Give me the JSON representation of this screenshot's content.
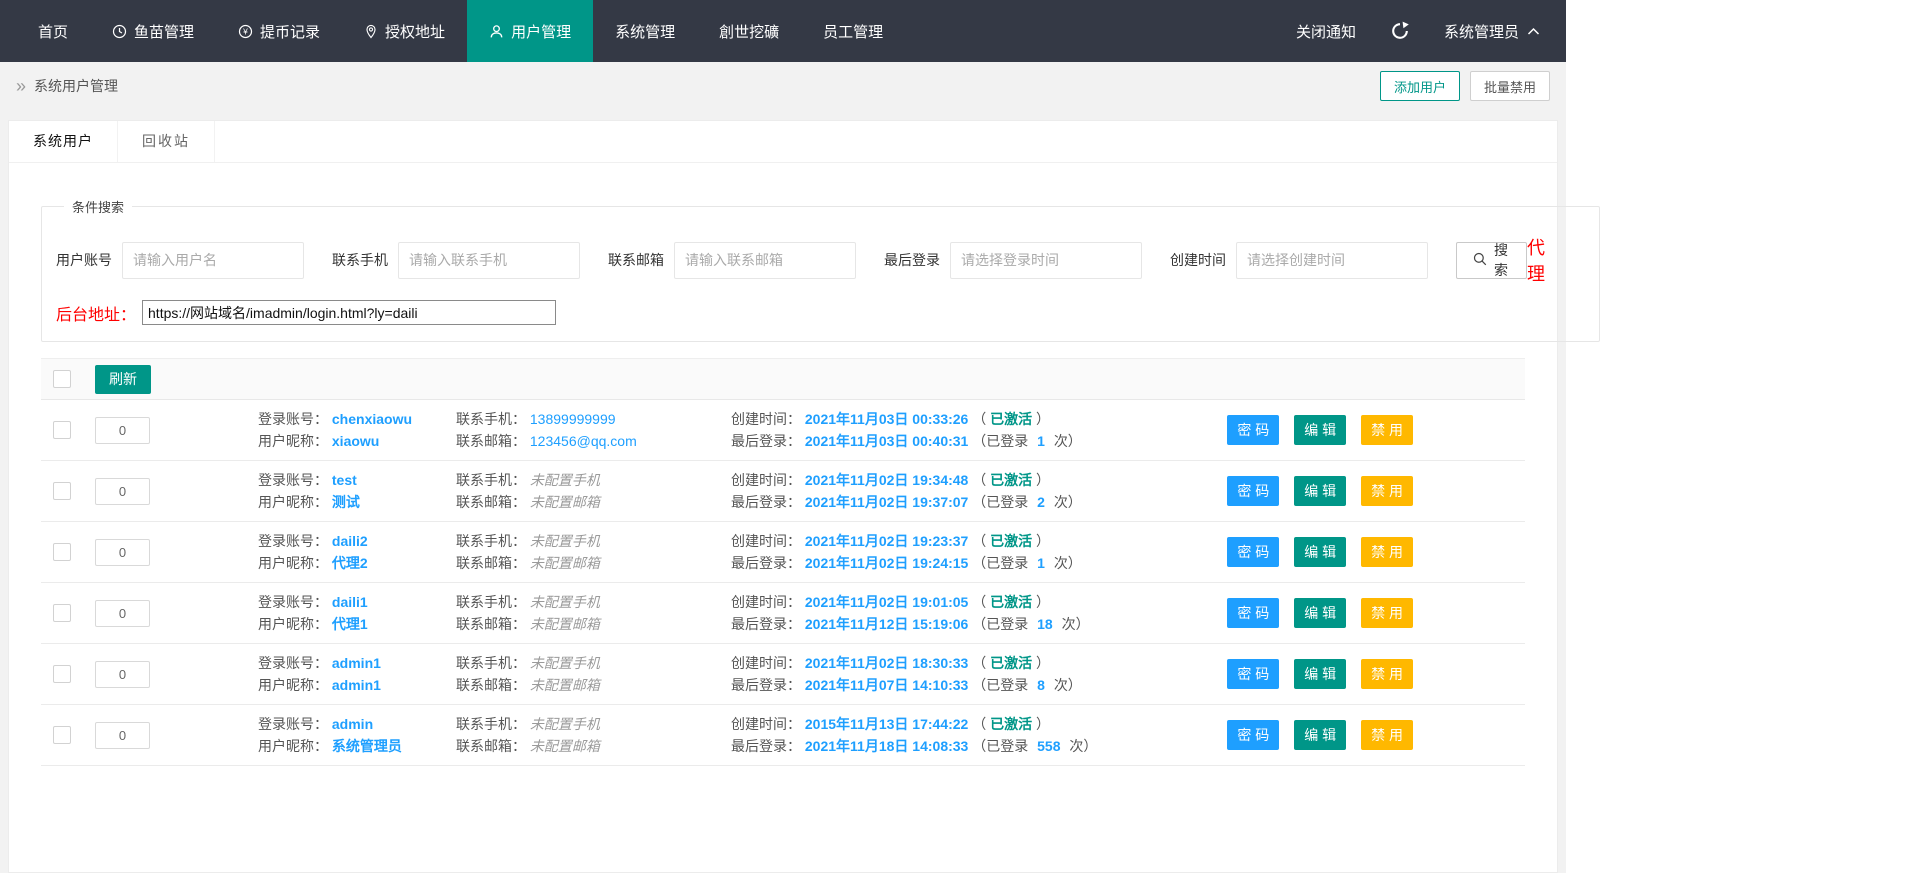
{
  "colors": {
    "nav_bg": "#343945",
    "primary_green": "#009688",
    "link_blue": "#1E9FFF",
    "warn_orange": "#FFB800",
    "alert_red": "#FF0000"
  },
  "icons": {
    "clock": "clock-icon",
    "yen": "yen-circle-icon",
    "pin": "location-pin-icon",
    "user": "user-icon",
    "refresh": "refresh-icon",
    "chevron_up": "chevron-up-icon",
    "search": "search-icon",
    "breadcrumb": "double-chevron-right-icon"
  },
  "nav": {
    "items": [
      {
        "label": "首页"
      },
      {
        "label": "鱼苗管理",
        "icon": "clock"
      },
      {
        "label": "提币记录",
        "icon": "yen"
      },
      {
        "label": "授权地址",
        "icon": "pin"
      },
      {
        "label": "用户管理",
        "icon": "user",
        "active": true
      },
      {
        "label": "系统管理"
      },
      {
        "label": "創世挖礦"
      },
      {
        "label": "员工管理"
      }
    ],
    "close_notice": "关闭通知",
    "admin_name": "系统管理员"
  },
  "breadcrumb": {
    "title": "系统用户管理",
    "add_user": "添加用户",
    "batch_disable": "批量禁用"
  },
  "tabs": {
    "tab1": "系统用户",
    "tab2": "回收站"
  },
  "search": {
    "legend": "条件搜索",
    "account_label": "用户账号",
    "account_placeholder": "请输入用户名",
    "phone_label": "联系手机",
    "phone_placeholder": "请输入联系手机",
    "email_label": "联系邮箱",
    "email_placeholder": "请输入联系邮箱",
    "last_login_label": "最后登录",
    "last_login_placeholder": "请选择登录时间",
    "created_label": "创建时间",
    "created_placeholder": "请选择创建时间",
    "search_button": "搜 索",
    "agent_text": "代理",
    "backend_label": "后台地址：",
    "backend_url": "https://网站域名/imadmin/login.html?ly=daili"
  },
  "table": {
    "refresh_button": "刷新",
    "labels": {
      "account": "登录账号：",
      "nickname": "用户昵称：",
      "phone": "联系手机：",
      "email": "联系邮箱：",
      "created": "创建时间：",
      "last_login": "最后登录：",
      "paren_open": "（",
      "activated": "已激活",
      "paren_close": "）",
      "login_prefix": "（已登录",
      "login_suffix": "次）"
    },
    "actions": {
      "password": "密 码",
      "edit": "编 辑",
      "disable": "禁 用"
    },
    "rows": [
      {
        "sort": "0",
        "account": "chenxiaowu",
        "nickname": "xiaowu",
        "phone": "13899999999",
        "phone_unset": false,
        "email": "123456@qq.com",
        "email_unset": false,
        "created": "2021年11月03日 00:33:26",
        "last_login": "2021年11月03日 00:40:31",
        "login_count": "1"
      },
      {
        "sort": "0",
        "account": "test",
        "nickname": "测试",
        "phone": "未配置手机",
        "phone_unset": true,
        "email": "未配置邮箱",
        "email_unset": true,
        "created": "2021年11月02日 19:34:48",
        "last_login": "2021年11月02日 19:37:07",
        "login_count": "2"
      },
      {
        "sort": "0",
        "account": "daili2",
        "nickname": "代理2",
        "phone": "未配置手机",
        "phone_unset": true,
        "email": "未配置邮箱",
        "email_unset": true,
        "created": "2021年11月02日 19:23:37",
        "last_login": "2021年11月02日 19:24:15",
        "login_count": "1"
      },
      {
        "sort": "0",
        "account": "daili1",
        "nickname": "代理1",
        "phone": "未配置手机",
        "phone_unset": true,
        "email": "未配置邮箱",
        "email_unset": true,
        "created": "2021年11月02日 19:01:05",
        "last_login": "2021年11月12日 15:19:06",
        "login_count": "18"
      },
      {
        "sort": "0",
        "account": "admin1",
        "nickname": "admin1",
        "phone": "未配置手机",
        "phone_unset": true,
        "email": "未配置邮箱",
        "email_unset": true,
        "created": "2021年11月02日 18:30:33",
        "last_login": "2021年11月07日 14:10:33",
        "login_count": "8"
      },
      {
        "sort": "0",
        "account": "admin",
        "nickname": "系统管理员",
        "phone": "未配置手机",
        "phone_unset": true,
        "email": "未配置邮箱",
        "email_unset": true,
        "created": "2015年11月13日 17:44:22",
        "last_login": "2021年11月18日 14:08:33",
        "login_count": "558"
      }
    ]
  }
}
